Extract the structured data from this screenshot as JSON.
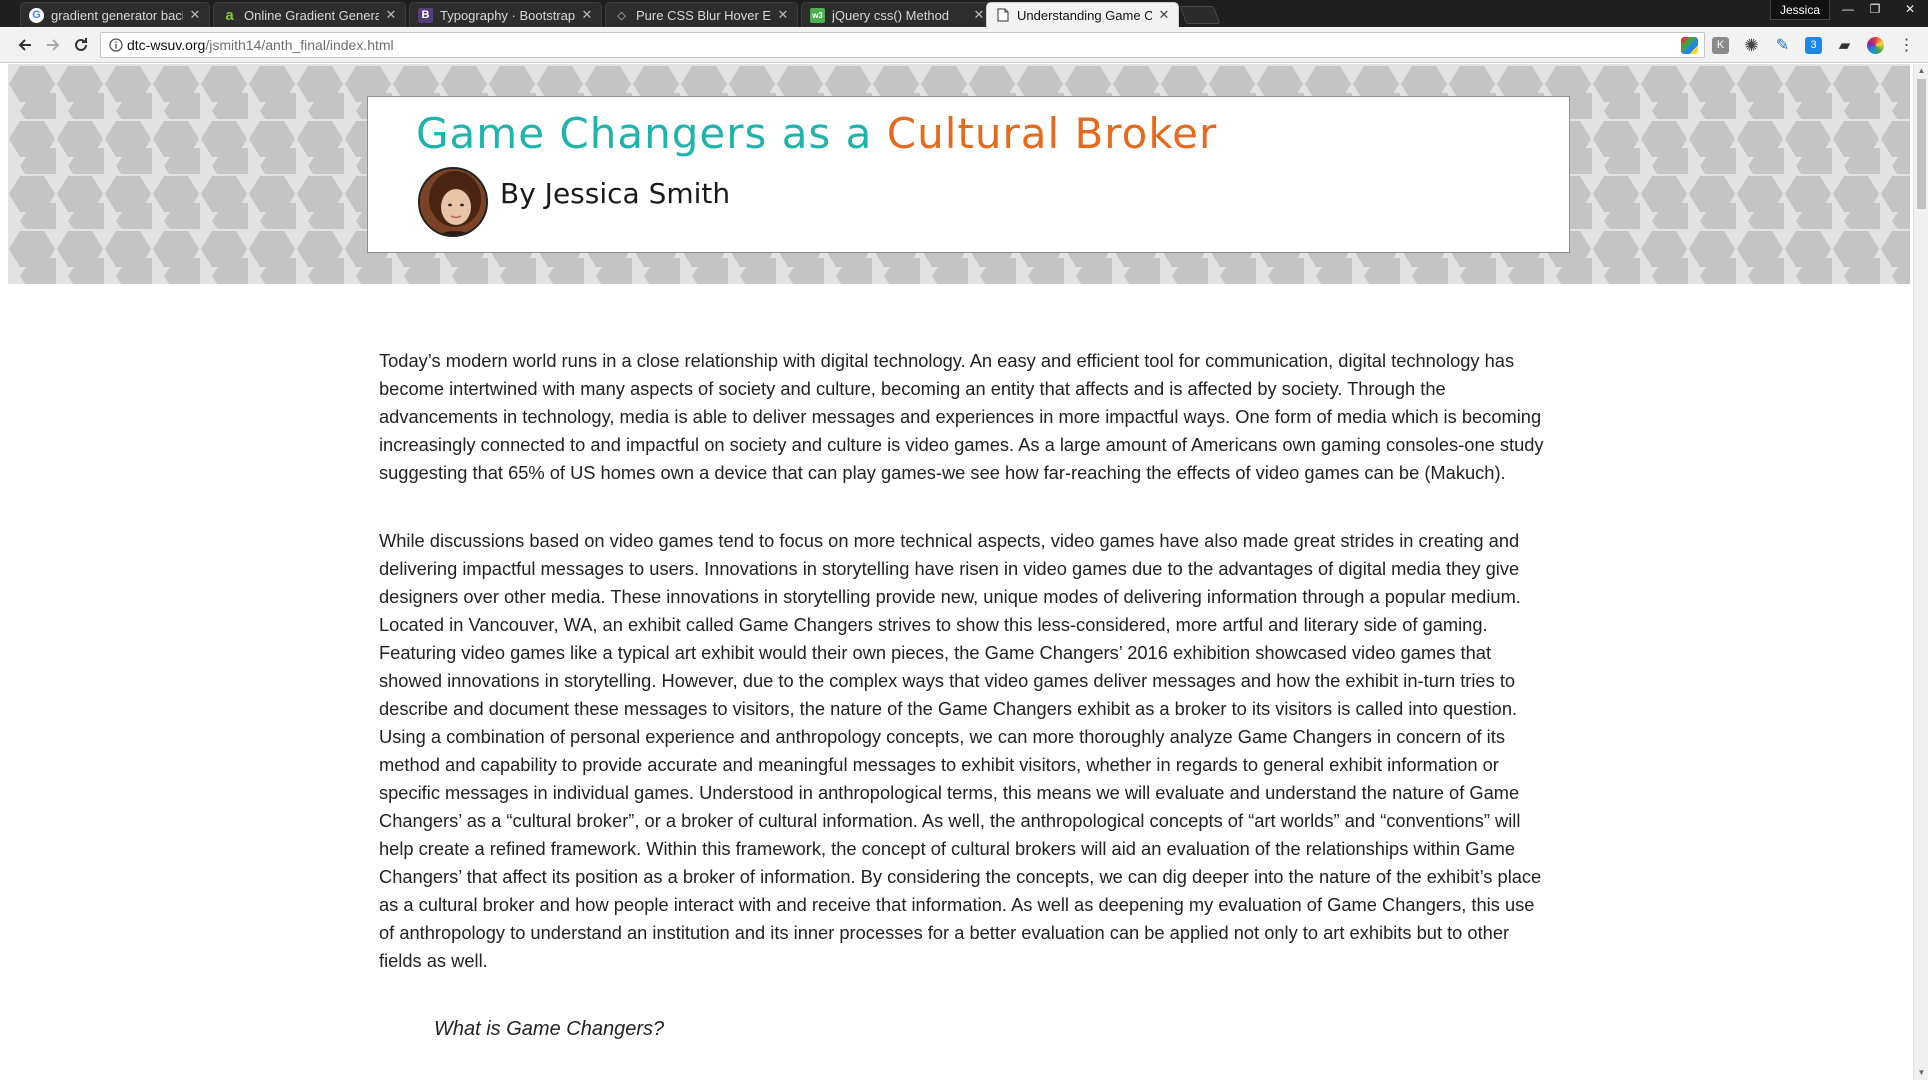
{
  "browser": {
    "tabs": [
      {
        "title": "gradient generator back",
        "favicon": "google-icon",
        "color": "#4285f4"
      },
      {
        "title": "Online Gradient Generat",
        "favicon": "a-letter-icon",
        "color": "#86c232"
      },
      {
        "title": "Typography · Bootstrap",
        "favicon": "bootstrap-icon",
        "color": "#563d7c"
      },
      {
        "title": "Pure CSS Blur Hover Effe",
        "favicon": "codepen-icon",
        "color": "#444444"
      },
      {
        "title": "jQuery css() Method",
        "favicon": "w3schools-icon",
        "color": "#4caf50"
      },
      {
        "title": "Understanding Game Ch",
        "favicon": "page-icon",
        "color": "#666666"
      }
    ],
    "profile_name": "Jessica",
    "url_host": "dtc-wsuv.org",
    "url_path": "/jsmith14/anth_final/index.html"
  },
  "header": {
    "title_part1": "Game Changers as a ",
    "title_part2": "Cultural Broker",
    "byline": "By Jessica Smith"
  },
  "colors": {
    "title_teal": "#1fb3ad",
    "title_orange": "#e66a1d",
    "hex_pattern": "#c6c6c6"
  },
  "article": {
    "p1": "Today’s modern world runs in a close relationship with digital technology. An easy and efficient tool for communication, digital technology has become intertwined with many aspects of society and culture, becoming an entity that affects and is affected by society. Through the advancements in technology, media is able to deliver messages and experiences in more impactful ways. One form of media which is becoming increasingly connected to and impactful on society and culture is video games. As a large amount of Americans own gaming consoles-one study suggesting that 65% of US homes own a device that can play games-we see how far-reaching the effects of video games can be (Makuch).",
    "p2": "While discussions based on video games tend to focus on more technical aspects, video games have also made great strides in creating and delivering impactful messages to users. Innovations in storytelling have risen in video games due to the advantages of digital media they give designers over other media. These innovations in storytelling provide new, unique modes of delivering information through a popular medium. Located in Vancouver, WA, an exhibit called Game Changers strives to show this less-considered, more artful and literary side of gaming. Featuring video games like a typical art exhibit would their own pieces, the Game Changers’ 2016 exhibition showcased video games that showed innovations in storytelling. However, due to the complex ways that video games deliver messages and how the exhibit in-turn tries to describe and document these messages to visitors, the nature of the Game Changers exhibit as a broker to its visitors is called into question. Using a combination of personal experience and anthropology concepts, we can more thoroughly analyze Game Changers in concern of its method and capability to provide accurate and meaningful messages to exhibit visitors, whether in regards to general exhibit information or specific messages in individual games. Understood in anthropological terms, this means we will evaluate and understand the nature of Game Changers’ as a “cultural broker”, or a broker of cultural information. As well, the anthropological concepts of “art worlds” and “conventions” will help create a refined framework. Within this framework, the concept of cultural brokers will aid an evaluation of the relationships within Game Changers’ that affect its position as a broker of information. By considering the concepts, we can dig deeper into the nature of the exhibit’s place as a cultural broker and how people interact with and receive that information. As well as deepening my evaluation of Game Changers, this use of anthropology to understand an institution and its inner processes for a better evaluation can be applied not only to art exhibits but to other fields as well.",
    "subhead": "What is Game Changers?"
  }
}
